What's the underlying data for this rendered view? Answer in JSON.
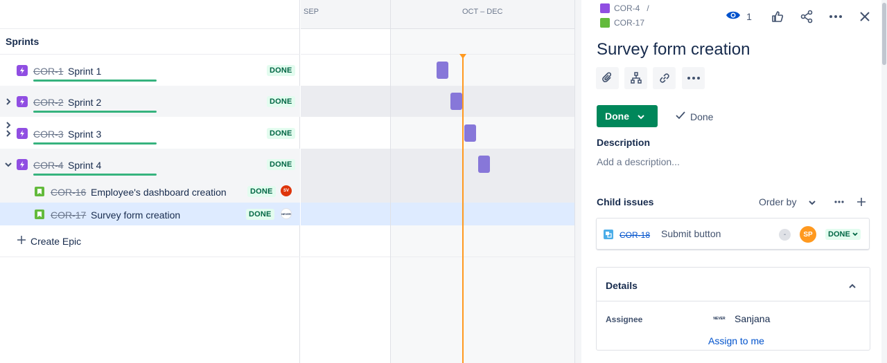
{
  "timeline": {
    "month_sep": "SEP",
    "quarter": "OCT – DEC",
    "sprints_header": "Sprints"
  },
  "epics": [
    {
      "key": "COR-1",
      "title": "Sprint 1",
      "status": "DONE",
      "progress": 1.0
    },
    {
      "key": "COR-2",
      "title": "Sprint 2",
      "status": "DONE",
      "progress": 1.0
    },
    {
      "key": "COR-3",
      "title": "Sprint 3",
      "status": "DONE",
      "progress": 1.0
    },
    {
      "key": "COR-4",
      "title": "Sprint 4",
      "status": "DONE",
      "progress": 1.0
    }
  ],
  "children": [
    {
      "key": "COR-16",
      "title": "Employee's dashboard creation",
      "status": "DONE",
      "avatar": "SV"
    },
    {
      "key": "COR-17",
      "title": "Survey form creation",
      "status": "DONE",
      "avatar": "NEVER"
    }
  ],
  "create_epic": "Create Epic",
  "panel": {
    "breadcrumb_parent": "COR-4",
    "breadcrumb_sep": "/",
    "breadcrumb_current": "COR-17",
    "watchers": "1",
    "title": "Survey form creation",
    "status_button": "Done",
    "resolution": "Done",
    "description_label": "Description",
    "description_placeholder": "Add a description...",
    "child_issues_label": "Child issues",
    "order_by": "Order by",
    "child": {
      "key": "COR-18",
      "title": "Submit button",
      "priority": "-",
      "avatar": "SP",
      "status": "DONE"
    },
    "details_label": "Details",
    "assignee_label": "Assignee",
    "assignee_name": "Sanjana",
    "assignee_avatar_text": "NEVER",
    "assign_to_me": "Assign to me"
  },
  "colors": {
    "epic": "#904ee2",
    "story": "#63ba3c",
    "done_green": "#00875a",
    "timeline_bar": "#8777d9",
    "today_line": "#ff991f"
  }
}
